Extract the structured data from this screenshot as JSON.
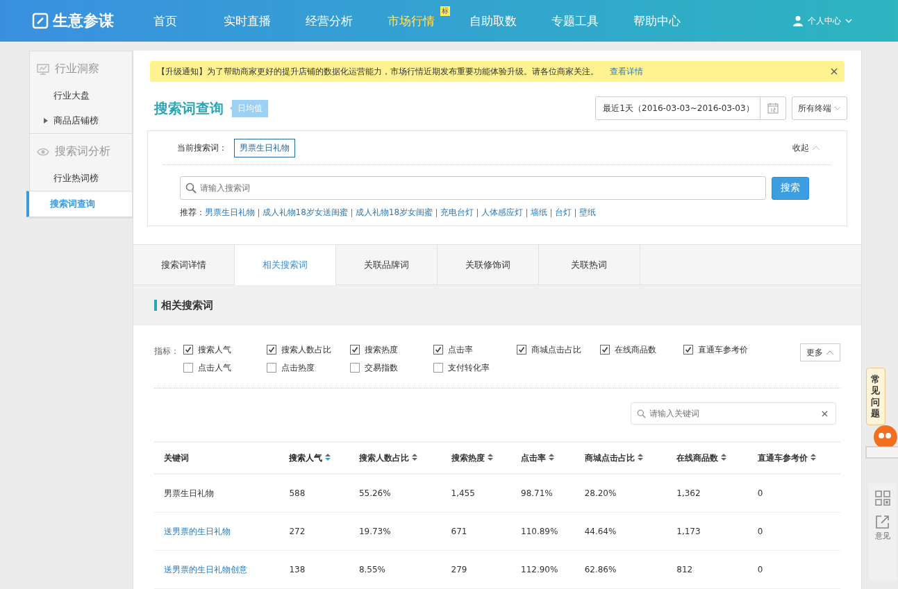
{
  "topbar": {
    "logo": "生意参谋",
    "nav": [
      {
        "label": "首页",
        "selected": false
      },
      {
        "label": "实时直播",
        "selected": false
      },
      {
        "label": "经营分析",
        "selected": false
      },
      {
        "label": "市场行情",
        "selected": true,
        "badge": "标"
      },
      {
        "label": "自助取数",
        "selected": false
      },
      {
        "label": "专题工具",
        "selected": false
      },
      {
        "label": "帮助中心",
        "selected": false
      }
    ],
    "user": "个人中心"
  },
  "sidebar": {
    "groups": [
      {
        "title": "行业洞察",
        "items": [
          {
            "label": "行业大盘",
            "selected": false,
            "expandable": false
          },
          {
            "label": "商品店铺榜",
            "selected": false,
            "expandable": true
          }
        ]
      },
      {
        "title": "搜索词分析",
        "items": [
          {
            "label": "行业热词榜",
            "selected": false,
            "expandable": false
          },
          {
            "label": "搜索词查询",
            "selected": true,
            "expandable": false
          }
        ]
      }
    ]
  },
  "notice": {
    "text": "【升级通知】为了帮助商家更好的提升店铺的数据化运营能力，市场行情近期发布重要功能体验升级。请各位商家关注。",
    "link": "查看详情"
  },
  "page": {
    "title": "搜索词查询",
    "tag": "日均值",
    "date_range": "最近1天（2016-03-03~2016-03-03）",
    "terminal": "所有终端"
  },
  "search_panel": {
    "current_label": "当前搜索词：",
    "current_term": "男票生日礼物",
    "collapse": "收起",
    "placeholder": "请输入搜索词",
    "button": "搜索",
    "recommend_label": "推荐：",
    "recommendations": [
      "男票生日礼物",
      "成人礼物18岁女送闺蜜",
      "成人礼物18岁女闺蜜",
      "充电台灯",
      "人体感应灯",
      "墙纸",
      "台灯",
      "壁纸"
    ]
  },
  "tabs": [
    {
      "label": "搜索词详情",
      "selected": false
    },
    {
      "label": "相关搜索词",
      "selected": true
    },
    {
      "label": "关联品牌词",
      "selected": false
    },
    {
      "label": "关联修饰词",
      "selected": false
    },
    {
      "label": "关联热词",
      "selected": false
    }
  ],
  "section_title": "相关搜索词",
  "indicators": {
    "label": "指标：",
    "more": "更多",
    "items": [
      {
        "label": "搜索人气",
        "checked": true
      },
      {
        "label": "搜索人数占比",
        "checked": true
      },
      {
        "label": "搜索热度",
        "checked": true
      },
      {
        "label": "点击率",
        "checked": true
      },
      {
        "label": "商城点击占比",
        "checked": true
      },
      {
        "label": "在线商品数",
        "checked": true
      },
      {
        "label": "直通车参考价",
        "checked": true
      },
      {
        "label": "点击人气",
        "checked": false
      },
      {
        "label": "点击热度",
        "checked": false
      },
      {
        "label": "交易指数",
        "checked": false
      },
      {
        "label": "支付转化率",
        "checked": false
      }
    ]
  },
  "filter": {
    "placeholder": "请输入关键词"
  },
  "table": {
    "columns": [
      {
        "label": "关键词",
        "sortable": false,
        "sorted": false
      },
      {
        "label": "搜索人气",
        "sortable": true,
        "sorted": true
      },
      {
        "label": "搜索人数占比",
        "sortable": true,
        "sorted": false
      },
      {
        "label": "搜索热度",
        "sortable": true,
        "sorted": false
      },
      {
        "label": "点击率",
        "sortable": true,
        "sorted": false
      },
      {
        "label": "商城点击占比",
        "sortable": true,
        "sorted": false
      },
      {
        "label": "在线商品数",
        "sortable": true,
        "sorted": false
      },
      {
        "label": "直通车参考价",
        "sortable": true,
        "sorted": false
      }
    ],
    "rows": [
      {
        "link": false,
        "cells": [
          "男票生日礼物",
          "588",
          "55.26%",
          "1,455",
          "98.71%",
          "28.20%",
          "1,362",
          "0"
        ]
      },
      {
        "link": true,
        "cells": [
          "送男票的生日礼物",
          "272",
          "19.73%",
          "671",
          "110.89%",
          "44.64%",
          "1,173",
          "0"
        ]
      },
      {
        "link": true,
        "cells": [
          "送男票的生日礼物创意",
          "138",
          "8.55%",
          "279",
          "112.90%",
          "62.86%",
          "812",
          "0"
        ]
      }
    ]
  },
  "float_bar": {
    "faq": "常见问题",
    "feedback": "意见"
  }
}
